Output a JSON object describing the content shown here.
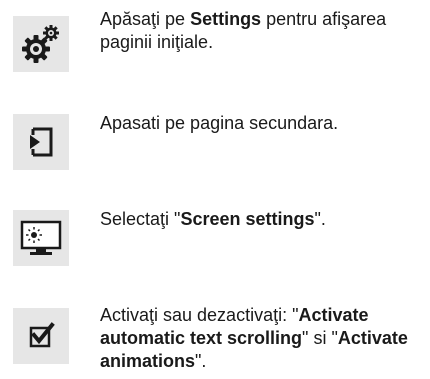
{
  "steps": [
    {
      "icon": "settings-gears-icon",
      "t1": "Apăsaţi pe ",
      "b1": "Settings",
      "t2": " pentru afişarea paginii iniţiale."
    },
    {
      "icon": "enter-page-icon",
      "t1": "Apasati pe pagina secundara."
    },
    {
      "icon": "screen-settings-monitor-icon",
      "t1": "Selectaţi \"",
      "b1": "Screen settings",
      "t2": "\"."
    },
    {
      "icon": "checkbox-checked-icon",
      "t1": "Activaţi sau dezactivaţi: \"",
      "b1": "Activate automatic text scrolling",
      "t2": "\" si \"",
      "b2": "Activate animations",
      "t3": "\"."
    }
  ]
}
